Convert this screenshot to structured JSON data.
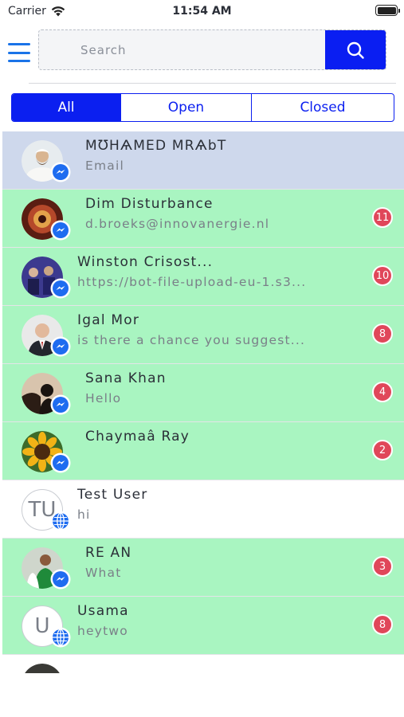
{
  "status_bar": {
    "carrier": "Carrier",
    "time": "11:54 AM"
  },
  "search": {
    "placeholder": "Search"
  },
  "filter_tabs": [
    {
      "label": "All",
      "active": true
    },
    {
      "label": "Open",
      "active": false
    },
    {
      "label": "Closed",
      "active": false
    }
  ],
  "conversations": [
    {
      "name": "MƱHѦMED MRѦbT",
      "preview": "Email",
      "badge": "",
      "channel": "messenger-icon",
      "state": "selected"
    },
    {
      "name": "Dim Disturbance",
      "preview": "d.broeks@innovanergie.nl",
      "badge": "11",
      "channel": "messenger-icon",
      "state": "unread"
    },
    {
      "name": "Winston Crisost...",
      "preview": "https://bot-file-upload-eu-1.s3...",
      "badge": "10",
      "channel": "messenger-icon",
      "state": "unread"
    },
    {
      "name": "Igal Mor",
      "preview": "is there a chance you suggest...",
      "badge": "8",
      "channel": "messenger-icon",
      "state": "unread"
    },
    {
      "name": "Sana Khan",
      "preview": "Hello",
      "badge": "4",
      "channel": "messenger-icon",
      "state": "unread"
    },
    {
      "name": "Chaymaâ Ray",
      "preview": "",
      "badge": "2",
      "channel": "messenger-icon",
      "state": "unread"
    },
    {
      "name": "Test User",
      "preview": "hi",
      "badge": "",
      "initials": "TU",
      "channel": "globe-icon",
      "state": "read"
    },
    {
      "name": "RE AN",
      "preview": "What",
      "badge": "3",
      "channel": "messenger-icon",
      "state": "unread"
    },
    {
      "name": "Usama",
      "preview": "heytwo",
      "badge": "8",
      "initials": "U",
      "channel": "globe-icon",
      "state": "unread"
    }
  ],
  "colors": {
    "accent": "#0b1ff0",
    "unread_row": "#a9f5c1",
    "selected_row": "#ced8ec",
    "badge": "#e0475a"
  }
}
